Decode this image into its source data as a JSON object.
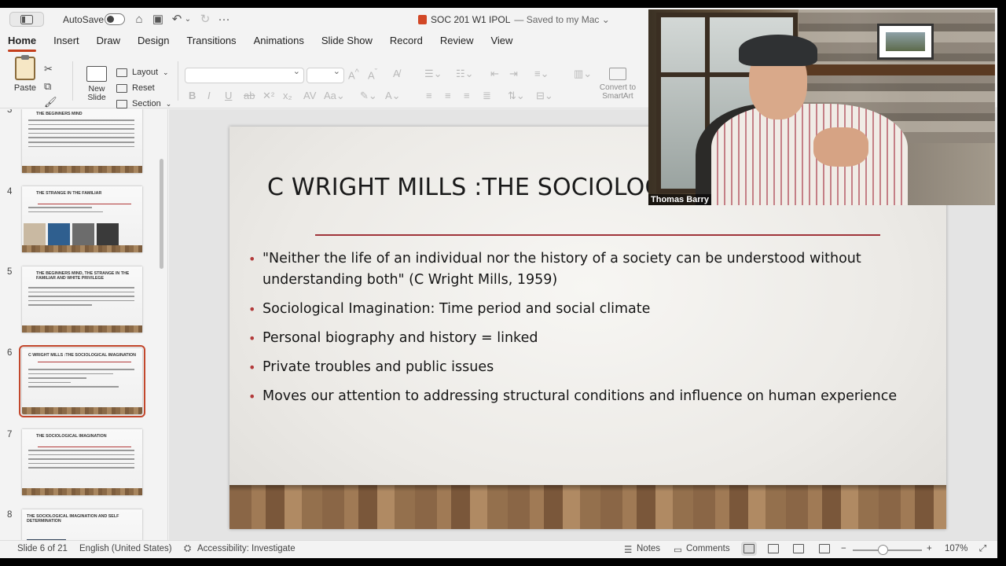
{
  "titlebar": {
    "autosave_label": "AutoSave",
    "doc_name": "SOC 201 W1 IPOL",
    "doc_status": "— Saved to my Mac ⌄"
  },
  "tabs": [
    "Home",
    "Insert",
    "Draw",
    "Design",
    "Transitions",
    "Animations",
    "Slide Show",
    "Record",
    "Review",
    "View"
  ],
  "ribbon": {
    "paste_label": "Paste",
    "new_slide_label": "New Slide",
    "layout_label": "Layout",
    "reset_label": "Reset",
    "section_label": "Section",
    "convert_smartart_label": "Convert to SmartArt"
  },
  "thumbnails": [
    {
      "number": "3",
      "title": "THE BEGINNERS MIND"
    },
    {
      "number": "4",
      "title": "THE STRANGE IN THE FAMILIAR"
    },
    {
      "number": "5",
      "title": "THE BEGINNERS MIND, THE STRANGE IN THE FAMILIAR AND WHITE PRIVILEGE"
    },
    {
      "number": "6",
      "title": "C WRIGHT MILLS :THE SOCIOLOGICAL IMAGINATION"
    },
    {
      "number": "7",
      "title": "THE SOCIOLOGICAL IMAGINATION"
    },
    {
      "number": "8",
      "title": "THE SOCIOLOGICAL IMAGINATION AND SELF DETERMINATION"
    }
  ],
  "slide": {
    "title": "C WRIGHT MILLS :THE SOCIOLOGIC",
    "bullets": [
      "\"Neither the life of an individual nor the history of a society can be understood without understanding both\"  (C Wright Mills, 1959)",
      "Sociological Imagination:  Time period and social climate",
      "Personal biography and history = linked",
      "Private troubles and public issues",
      "Moves our attention to addressing structural conditions and influence on human experience"
    ]
  },
  "webcam": {
    "participant_name": "Thomas Barry"
  },
  "statusbar": {
    "slide_counter": "Slide 6 of 21",
    "language": "English (United States)",
    "accessibility": "Accessibility: Investigate",
    "notes_label": "Notes",
    "comments_label": "Comments",
    "zoom_level": "107%",
    "zoom_fraction": 0.43
  },
  "colors": {
    "accent": "#c43e1c",
    "slide_rule": "#a0343a",
    "bullet": "#b23a3a"
  }
}
